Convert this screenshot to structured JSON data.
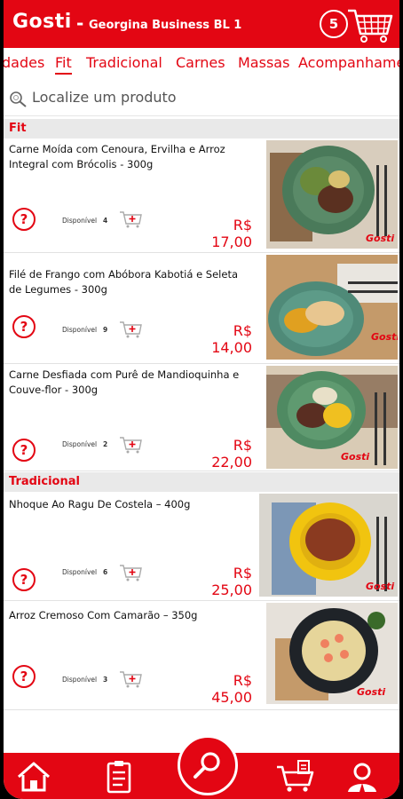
{
  "header": {
    "brand": "Gosti",
    "separator": "-",
    "store": "Georgina Business BL 1",
    "cart_count": "5"
  },
  "categories": [
    {
      "label": "dades",
      "active": false
    },
    {
      "label": "Fit",
      "active": true
    },
    {
      "label": "Tradicional",
      "active": false
    },
    {
      "label": "Carnes",
      "active": false
    },
    {
      "label": "Massas",
      "active": false
    },
    {
      "label": "Acompanhame",
      "active": false
    }
  ],
  "search": {
    "placeholder": "Localize um produto"
  },
  "sections": [
    {
      "title": "Fit"
    },
    {
      "title": "Tradicional"
    }
  ],
  "products": [
    {
      "name": "Carne Moída com Cenoura, Ervilha e Arroz Integral com Brócolis - 300g",
      "available_label": "Disponível",
      "quantity": "4",
      "price": "R$ 17,00",
      "help": "?"
    },
    {
      "name": "Filé de Frango com Abóbora Kabotiá e Seleta de Legumes - 300g",
      "available_label": "Disponível",
      "quantity": "9",
      "price": "R$ 14,00",
      "help": "?"
    },
    {
      "name": "Carne Desfiada com Purê de Mandioquinha e Couve-flor - 300g",
      "available_label": "Disponível",
      "quantity": "2",
      "price": "R$ 22,00",
      "help": "?"
    },
    {
      "name": "Nhoque Ao Ragu De Costela – 400g",
      "available_label": "Disponível",
      "quantity": "6",
      "price": "R$ 25,00",
      "help": "?"
    },
    {
      "name": "Arroz Cremoso Com Camarão – 350g",
      "available_label": "Disponível",
      "quantity": "3",
      "price": "R$ 45,00",
      "help": "?"
    }
  ],
  "plate_brand": "Gosti",
  "bottom_nav": [
    "home-icon",
    "order-list-icon",
    "search-icon",
    "shopping-cart-icon",
    "user-icon"
  ],
  "colors": {
    "accent": "#e30613",
    "section_bg": "#e9e9e9",
    "white": "#ffffff"
  }
}
